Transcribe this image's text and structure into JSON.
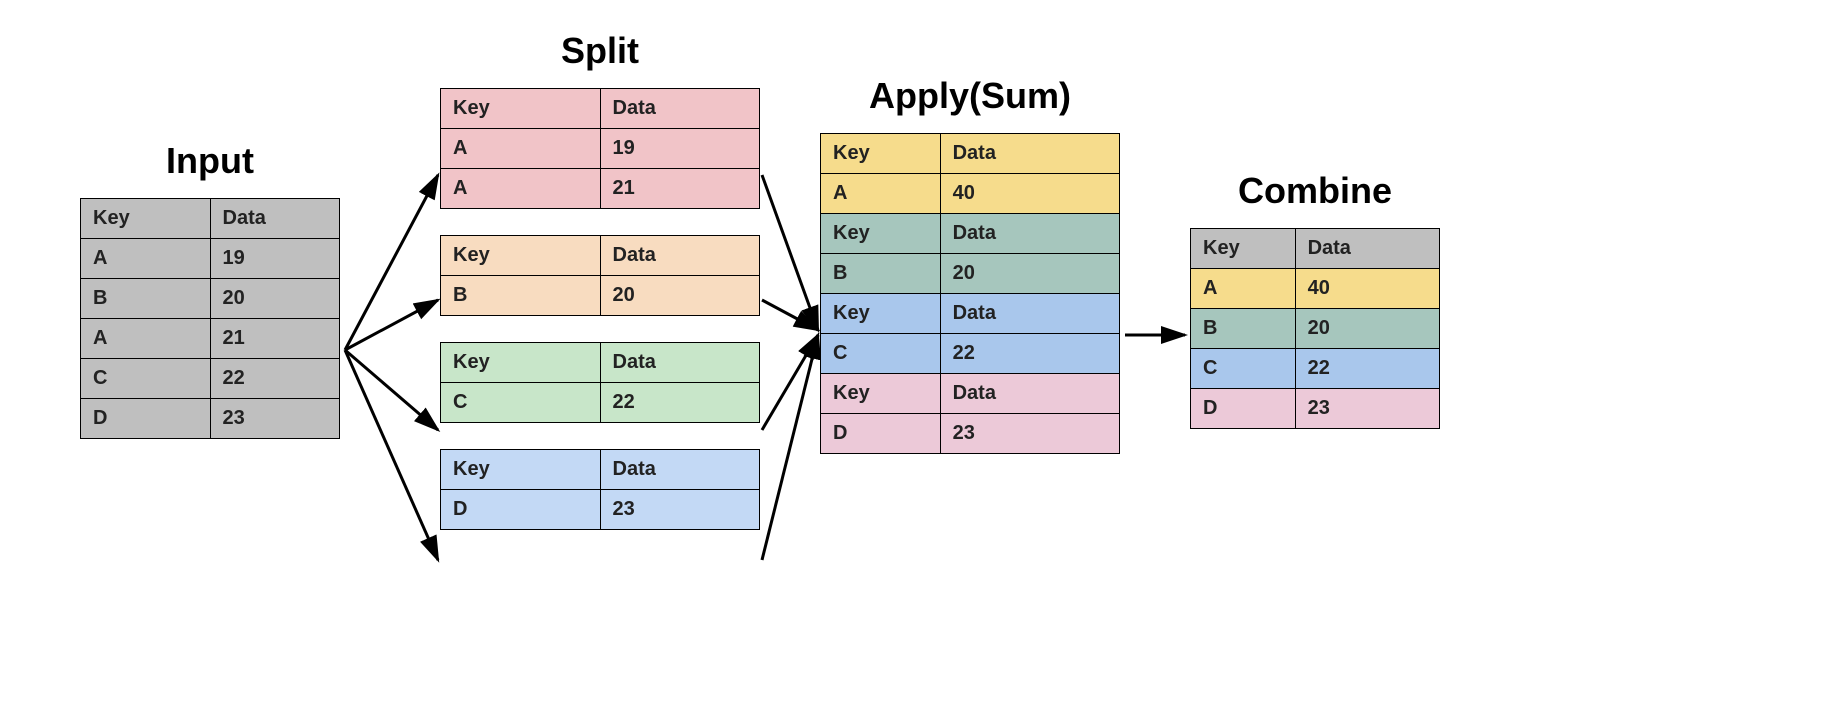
{
  "headings": {
    "input": "Input",
    "split": "Split",
    "apply": "Apply(Sum)",
    "combine": "Combine"
  },
  "cols": {
    "key": "Key",
    "data": "Data"
  },
  "input": {
    "rows": [
      {
        "k": "A",
        "v": "19"
      },
      {
        "k": "B",
        "v": "20"
      },
      {
        "k": "A",
        "v": "21"
      },
      {
        "k": "C",
        "v": "22"
      },
      {
        "k": "D",
        "v": "23"
      }
    ]
  },
  "split": {
    "groups": [
      {
        "color": "#f1c4c8",
        "rows": [
          {
            "k": "A",
            "v": "19"
          },
          {
            "k": "A",
            "v": "21"
          }
        ]
      },
      {
        "color": "#f8dcc0",
        "rows": [
          {
            "k": "B",
            "v": "20"
          }
        ]
      },
      {
        "color": "#c8e6c9",
        "rows": [
          {
            "k": "C",
            "v": "22"
          }
        ]
      },
      {
        "color": "#c3d9f5",
        "rows": [
          {
            "k": "D",
            "v": "23"
          }
        ]
      }
    ]
  },
  "apply": {
    "groups": [
      {
        "color": "#f6dc8c",
        "row": {
          "k": "A",
          "v": "40"
        }
      },
      {
        "color": "#a6c6bd",
        "row": {
          "k": "B",
          "v": "20"
        }
      },
      {
        "color": "#a9c7ec",
        "row": {
          "k": "C",
          "v": "22"
        }
      },
      {
        "color": "#ecc9d8",
        "row": {
          "k": "D",
          "v": "23"
        }
      }
    ]
  },
  "combine": {
    "headerColor": "#bfbfbf",
    "rows": [
      {
        "color": "#f6dc8c",
        "k": "A",
        "v": "40"
      },
      {
        "color": "#a6c6bd",
        "k": "B",
        "v": "20"
      },
      {
        "color": "#a9c7ec",
        "k": "C",
        "v": "22"
      },
      {
        "color": "#ecc9d8",
        "k": "D",
        "v": "23"
      }
    ]
  },
  "colors": {
    "inputBg": "#bfbfbf"
  }
}
